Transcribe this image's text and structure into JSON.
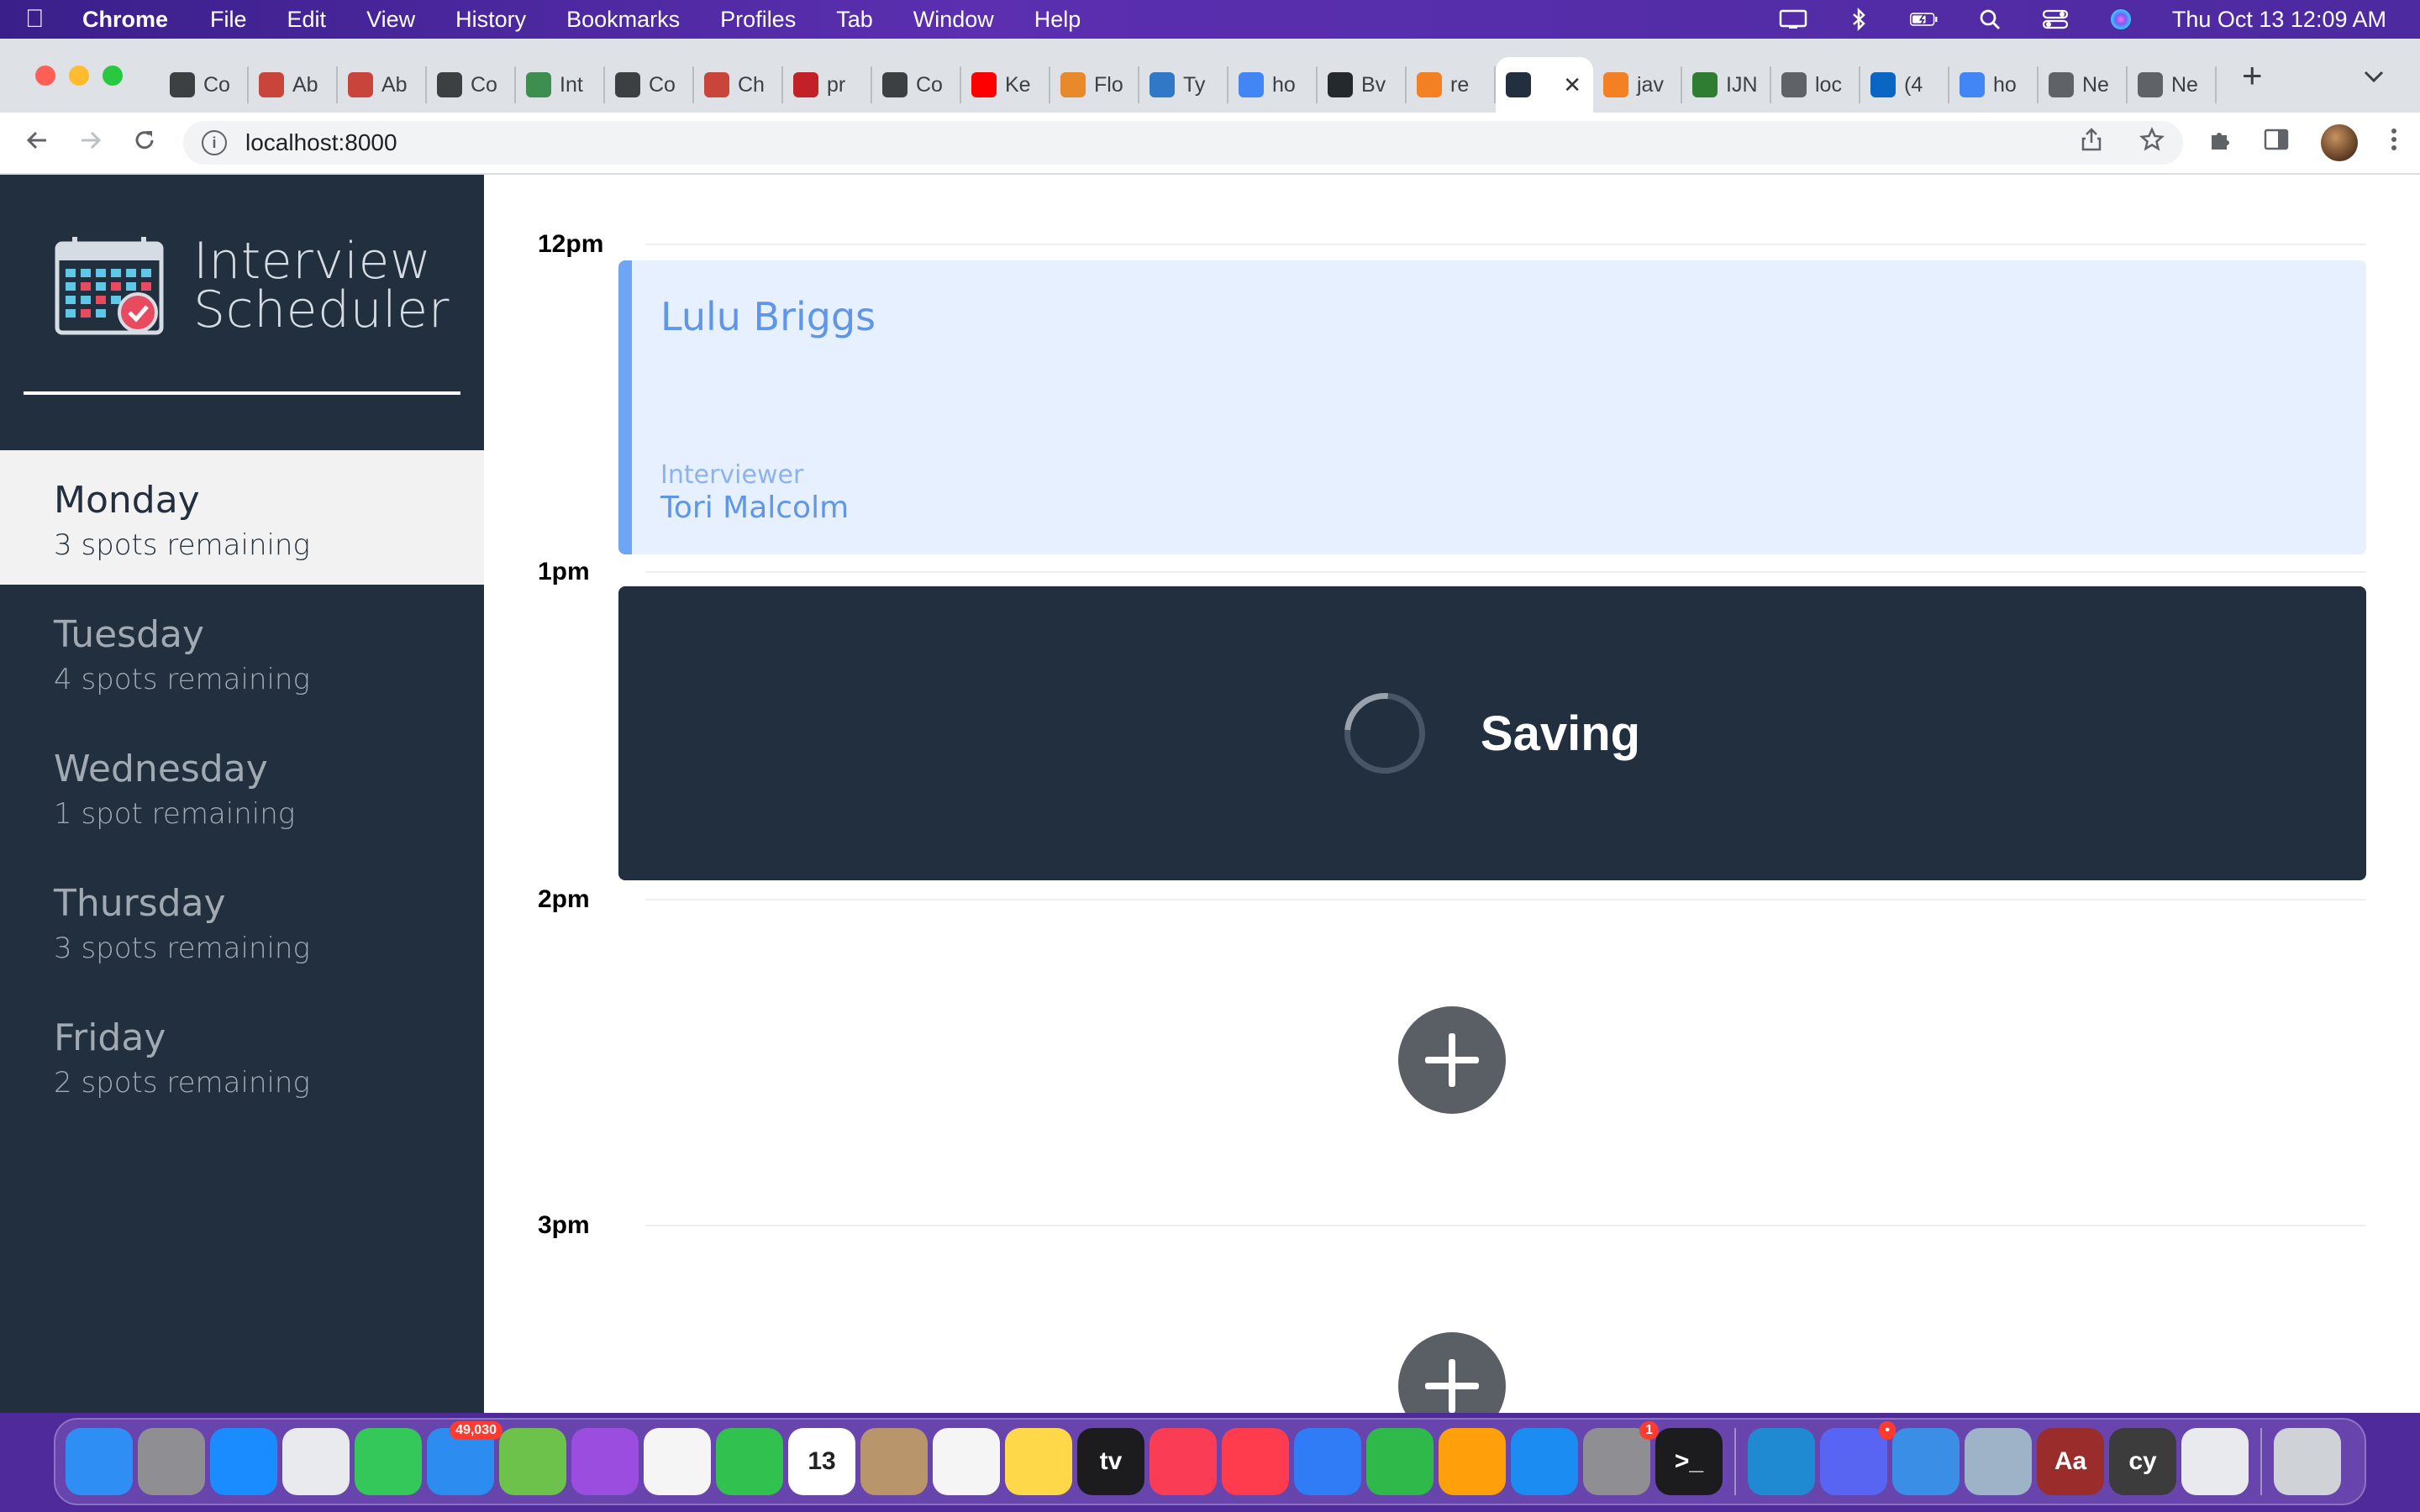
{
  "menubar": {
    "app": "Chrome",
    "items": [
      "File",
      "Edit",
      "View",
      "History",
      "Bookmarks",
      "Profiles",
      "Tab",
      "Window",
      "Help"
    ],
    "clock": "Thu Oct 13  12:09 AM"
  },
  "tabs": [
    {
      "label": "Co",
      "icon": "compass-icon",
      "color": "#3c4043"
    },
    {
      "label": "Ab",
      "icon": "octopus-icon",
      "color": "#c9453b"
    },
    {
      "label": "Ab",
      "icon": "octopus-icon",
      "color": "#c9453b"
    },
    {
      "label": "Co",
      "icon": "compass-icon",
      "color": "#3c4043"
    },
    {
      "label": "Int",
      "icon": "cypress-icon",
      "color": "#3c8f4f"
    },
    {
      "label": "Co",
      "icon": "compass-icon",
      "color": "#3c4043"
    },
    {
      "label": "Ch",
      "icon": "octopus-icon",
      "color": "#c9453b"
    },
    {
      "label": "pr",
      "icon": "pr-icon",
      "color": "#c12127"
    },
    {
      "label": "Co",
      "icon": "compass-icon",
      "color": "#3c4043"
    },
    {
      "label": "Ke",
      "icon": "youtube-icon",
      "color": "#ff0000"
    },
    {
      "label": "Flo",
      "icon": "flow-icon",
      "color": "#e8892c"
    },
    {
      "label": "Ty",
      "icon": "typescript-icon",
      "color": "#3178c6"
    },
    {
      "label": "ho",
      "icon": "google-icon",
      "color": "#4285f4"
    },
    {
      "label": "Bv",
      "icon": "github-icon",
      "color": "#24292e"
    },
    {
      "label": "re",
      "icon": "stackoverflow-icon",
      "color": "#f48024"
    },
    {
      "label": "",
      "icon": "react-icon",
      "color": "#222f3e",
      "active": true
    },
    {
      "label": "jav",
      "icon": "stackoverflow-icon",
      "color": "#f48024"
    },
    {
      "label": "IJN",
      "icon": "ijn-icon",
      "color": "#2e7d32"
    },
    {
      "label": "loc",
      "icon": "globe-icon",
      "color": "#5f6368"
    },
    {
      "label": "(4",
      "icon": "linkedin-icon",
      "color": "#0a66c2"
    },
    {
      "label": "ho",
      "icon": "google-icon",
      "color": "#4285f4"
    },
    {
      "label": "Ne",
      "icon": "chrome-icon",
      "color": "#5f6368"
    },
    {
      "label": "Ne",
      "icon": "chrome-icon",
      "color": "#5f6368"
    }
  ],
  "toolbar": {
    "url": "localhost:8000"
  },
  "app": {
    "title_line1": "Interview",
    "title_line2": "Scheduler",
    "days": [
      {
        "name": "Monday",
        "spots": "3 spots remaining",
        "selected": true
      },
      {
        "name": "Tuesday",
        "spots": "4 spots remaining"
      },
      {
        "name": "Wednesday",
        "spots": "1 spot remaining"
      },
      {
        "name": "Thursday",
        "spots": "3 spots remaining"
      },
      {
        "name": "Friday",
        "spots": "2 spots remaining"
      }
    ],
    "slots": [
      {
        "time": "12pm"
      },
      {
        "time": "1pm"
      },
      {
        "time": "2pm"
      },
      {
        "time": "3pm"
      }
    ],
    "appointment": {
      "student": "Lulu Briggs",
      "interviewer_label": "Interviewer",
      "interviewer": "Tori Malcolm"
    },
    "status": "Saving"
  },
  "dock": {
    "apps": [
      {
        "name": "finder-icon",
        "color": "#2f8ef4"
      },
      {
        "name": "launchpad-icon",
        "color": "#8e8e93"
      },
      {
        "name": "safari-icon",
        "color": "#1a8cff"
      },
      {
        "name": "chrome-icon",
        "color": "#e8eaed"
      },
      {
        "name": "messages-icon",
        "color": "#34c759"
      },
      {
        "name": "mail-icon",
        "color": "#2d8cf0",
        "badge": "49,030"
      },
      {
        "name": "maps-icon",
        "color": "#6cc24a"
      },
      {
        "name": "podcasts-icon",
        "color": "#9b4de0"
      },
      {
        "name": "photos-icon",
        "color": "#f5f5f5"
      },
      {
        "name": "facetime-icon",
        "color": "#30c14e"
      },
      {
        "name": "calendar-icon",
        "color": "#ffffff",
        "text": "13"
      },
      {
        "name": "contacts-icon",
        "color": "#b8956a"
      },
      {
        "name": "reminders-icon",
        "color": "#f5f5f5"
      },
      {
        "name": "notes-icon",
        "color": "#ffd84a"
      },
      {
        "name": "tv-icon",
        "color": "#1c1c1e",
        "text": "tv"
      },
      {
        "name": "music-icon",
        "color": "#fa3d55"
      },
      {
        "name": "news-icon",
        "color": "#ff3b4e"
      },
      {
        "name": "keynote-icon",
        "color": "#2f7cf6"
      },
      {
        "name": "numbers-icon",
        "color": "#2fb94a"
      },
      {
        "name": "pages-icon",
        "color": "#ff9f0a"
      },
      {
        "name": "appstore-icon",
        "color": "#1b8cf2"
      },
      {
        "name": "system-preferences-icon",
        "color": "#8e8e93",
        "badge": "1"
      },
      {
        "name": "terminal-icon",
        "color": "#1c1c1e",
        "text": ">_"
      },
      {
        "name": "vscode-icon",
        "color": "#1f8ad2",
        "separator_before": true
      },
      {
        "name": "discord-icon",
        "color": "#5865f2",
        "badge": "•"
      },
      {
        "name": "xcode-icon",
        "color": "#3a8ee6"
      },
      {
        "name": "preview-icon",
        "color": "#9fb3c8"
      },
      {
        "name": "dictionary-icon",
        "color": "#9b2c2c",
        "text": "Aa"
      },
      {
        "name": "cypress-icon",
        "color": "#3c3c3c",
        "text": "cy"
      },
      {
        "name": "chrome-icon",
        "color": "#e8eaed"
      },
      {
        "name": "trash-icon",
        "color": "#cfd3d8",
        "separator_before": true
      }
    ]
  }
}
